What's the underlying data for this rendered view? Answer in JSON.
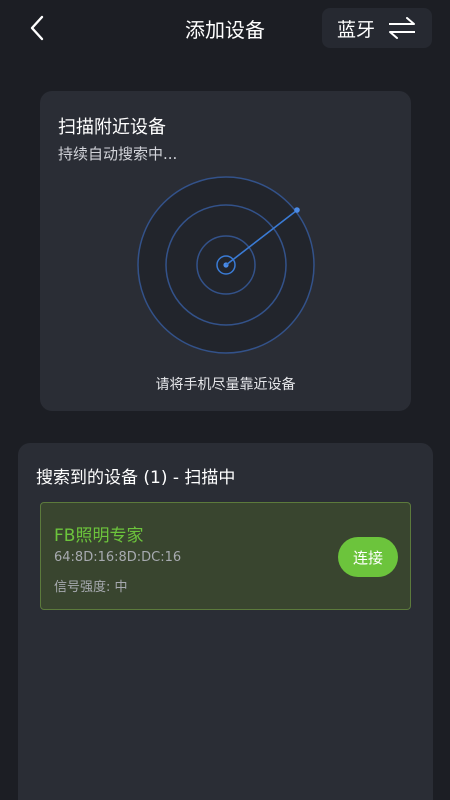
{
  "header": {
    "title": "添加设备",
    "mode_label": "蓝牙",
    "back_icon": "chevron-left-icon",
    "switch_icon": "swap-arrows-icon"
  },
  "scan": {
    "title": "扫描附近设备",
    "status": "持续自动搜索中...",
    "hint": "请将手机尽量靠近设备"
  },
  "results": {
    "title": "搜索到的设备 (1) - 扫描中",
    "devices": [
      {
        "name": "FB照明专家",
        "mac": "64:8D:16:8D:DC:16",
        "signal": "信号强度: 中",
        "action_label": "连接"
      }
    ]
  },
  "colors": {
    "background": "#1c1e24",
    "card": "#2a2d35",
    "accent_green": "#6cc43c",
    "radar_blue": "#3a7bd5",
    "device_bg": "#39452f"
  }
}
